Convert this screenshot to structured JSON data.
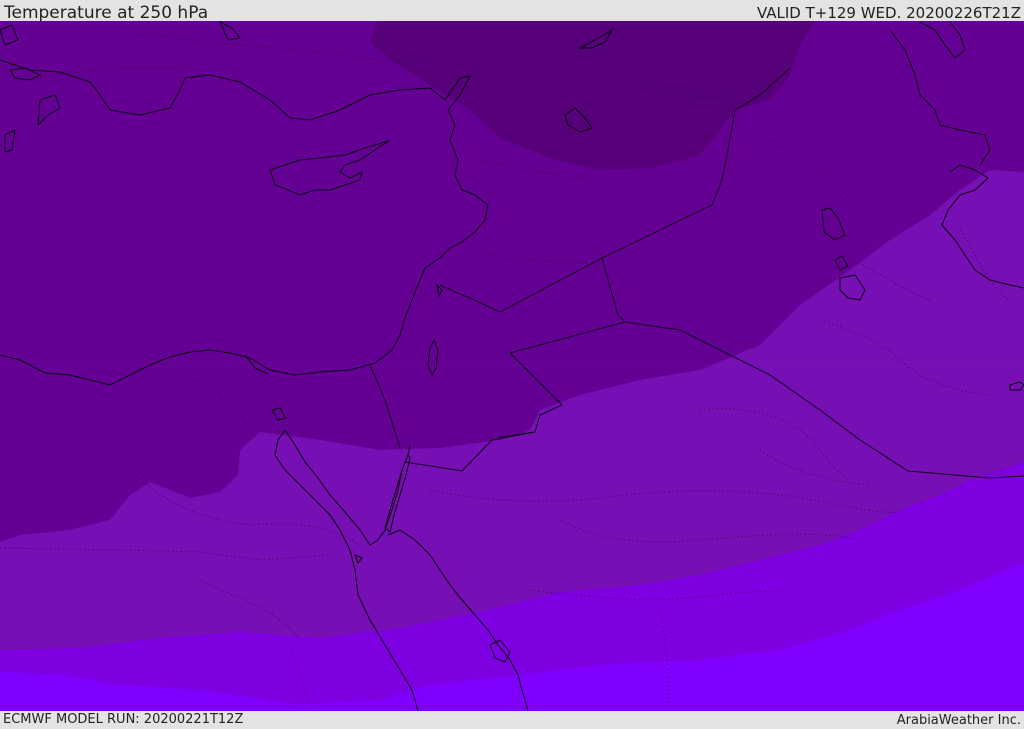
{
  "header": {
    "title": "Temperature at 250 hPa",
    "valid": "VALID T+129 WED. 20200226T21Z"
  },
  "footer": {
    "model_run": "ECMWF MODEL RUN: 20200221T12Z",
    "credit": "ArabiaWeather Inc."
  },
  "map": {
    "colors": {
      "band_coldest": "#56007a",
      "band_cold": "#650094",
      "band_mid": "#7610b4",
      "band_warm": "#7e00e2",
      "band_warmest": "#8000ff",
      "coastline": "#0a0010",
      "border": "#140020"
    }
  }
}
